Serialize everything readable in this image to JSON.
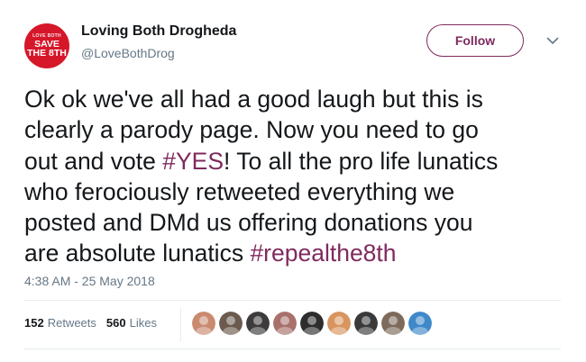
{
  "author": {
    "avatar_text": {
      "top": "LOVE BOTH",
      "mid": "SAVE",
      "bottom": "THE 8TH"
    },
    "display_name": "Loving Both Drogheda",
    "handle": "@LoveBothDrog"
  },
  "follow_label": "Follow",
  "text": {
    "line1": "Ok ok we've all had a good laugh but this is",
    "line2": "clearly a parody page. Now you need to go",
    "line3a": "out and vote ",
    "line3_hashtag": "#YES",
    "line3b": "! To all the pro life lunatics",
    "line4": "who ferociously retweeted everything we",
    "line5": "posted and DMd us offering donations you",
    "line6a": "are absolute lunatics ",
    "line6_hashtag": "#repealthe8th"
  },
  "timestamp": "4:38 AM - 25 May 2018",
  "stats": {
    "retweets_count": "152",
    "retweets_label": "Retweets",
    "likes_count": "560",
    "likes_label": "Likes"
  },
  "likers": [
    {
      "name": "liker-avatar-1",
      "color": "#c98a70"
    },
    {
      "name": "liker-avatar-2",
      "color": "#6b5a4e"
    },
    {
      "name": "liker-avatar-3",
      "color": "#3d3b3b"
    },
    {
      "name": "liker-avatar-4",
      "color": "#a8716b"
    },
    {
      "name": "liker-avatar-5",
      "color": "#2d2d2d"
    },
    {
      "name": "liker-avatar-6",
      "color": "#d9955f"
    },
    {
      "name": "liker-avatar-7",
      "color": "#3a3a3a"
    },
    {
      "name": "liker-avatar-8",
      "color": "#7d6a5a"
    },
    {
      "name": "liker-avatar-9",
      "color": "#3f88c9"
    }
  ],
  "colors": {
    "accent": "#7f2a5e",
    "avatar_bg": "#d6172a",
    "secondary_text": "#657786",
    "divider": "#e6ecf0"
  },
  "icons": {
    "caret": "chevron-down-icon"
  }
}
